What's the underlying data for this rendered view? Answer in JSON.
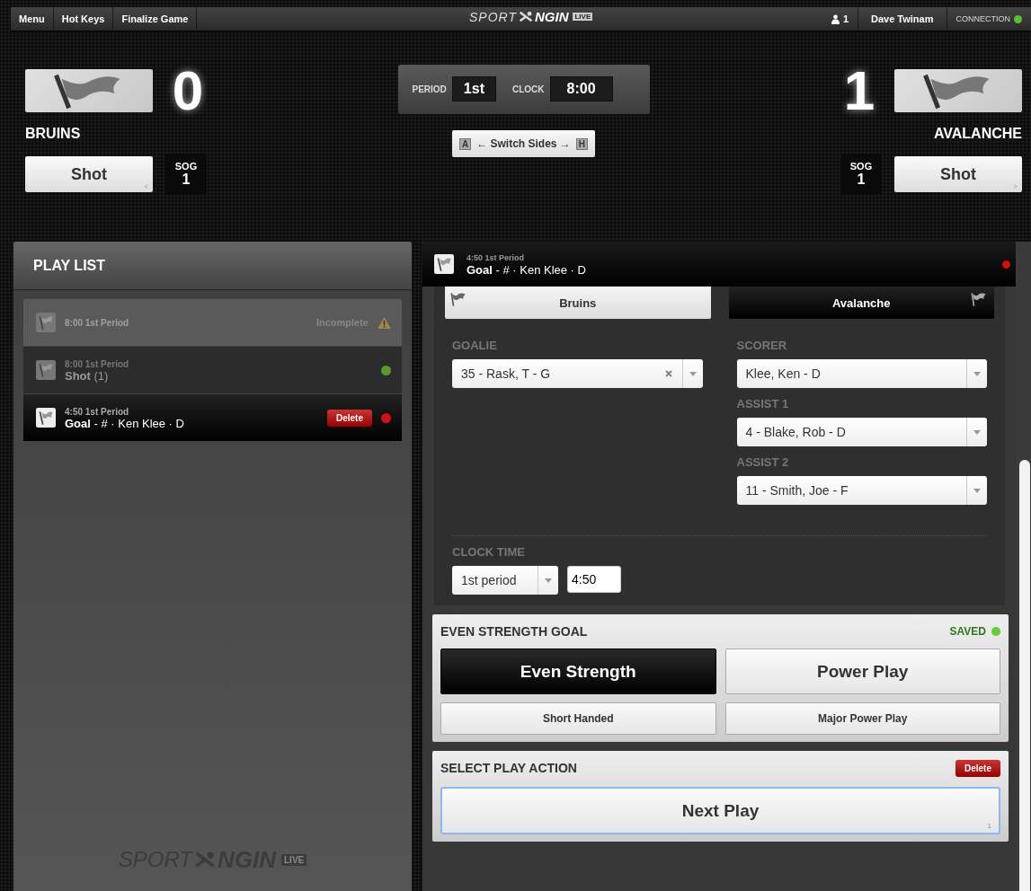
{
  "top_bar": {
    "menu_items": [
      "Menu",
      "Hot Keys",
      "Finalize Game"
    ],
    "logo": {
      "left": "SPORT",
      "right": "NGIN",
      "badge": "LIVE"
    },
    "user_count": "1",
    "user_name": "Dave Twinam",
    "connection": {
      "label": "CONNECTION",
      "connected": true
    }
  },
  "scoreboard": {
    "teams": [
      {
        "name": "BRUINS",
        "score": "0",
        "button": "Shot",
        "hotkey": "<",
        "sog_label": "SOG",
        "sog": "1"
      },
      {
        "name": "AVALANCHE",
        "score": "1",
        "button": "Shot",
        "hotkey": ">",
        "sog_label": "SOG",
        "sog": "1"
      }
    ],
    "period": {
      "label": "PERIOD",
      "value": "1st"
    },
    "clock": {
      "label": "CLOCK",
      "value": "8:00"
    },
    "switch_sides": {
      "left_badge": "A",
      "label": "← Switch Sides →",
      "right_badge": "H"
    }
  },
  "play_list": {
    "title": "PLAY LIST",
    "items": [
      {
        "time": "8:00 1st Period",
        "kind": "incomplete",
        "status_label": "Incomplete",
        "selected": false
      },
      {
        "time": "8:00 1st Period",
        "title": "**Shot** (1)",
        "kind": "saved",
        "selected": false
      },
      {
        "time": "4:50 1st Period",
        "title": "**Goal** - # · Ken Klee · D",
        "kind": "error",
        "delete_label": "Delete",
        "selected": true
      }
    ],
    "footer_logo": {
      "left": "SPORT",
      "right": "NGIN",
      "badge": "LIVE"
    }
  },
  "detail": {
    "header": {
      "time": "4:50 1st Period",
      "title": "**Goal** - # · Ken Klee · D",
      "color": "#d40f0f"
    },
    "team_tabs": [
      {
        "label": "Bruins",
        "selected": false
      },
      {
        "label": "Avalanche",
        "selected": true
      }
    ],
    "left_fields": [
      {
        "label": "GOALIE",
        "value": "35 - Rask, T - G",
        "clearable": true
      }
    ],
    "right_fields": [
      {
        "label": "SCORER",
        "value": "Klee, Ken - D",
        "clearable": false
      },
      {
        "label": "ASSIST 1",
        "value": "4 - Blake, Rob - D",
        "clearable": false
      },
      {
        "label": "ASSIST 2",
        "value": "11 - Smith, Joe - F",
        "clearable": false
      }
    ],
    "clock_time": {
      "label": "CLOCK TIME",
      "period": "1st period",
      "time": "4:50"
    }
  },
  "goal_type": {
    "title": "EVEN STRENGTH GOAL",
    "saved_label": "SAVED",
    "options": [
      {
        "label": "Even Strength",
        "kind": "large",
        "selected": true
      },
      {
        "label": "Power Play",
        "kind": "large",
        "selected": false
      },
      {
        "label": "Short Handed",
        "kind": "small",
        "selected": false
      },
      {
        "label": "Major Power Play",
        "kind": "small",
        "selected": false
      }
    ]
  },
  "play_action": {
    "title": "SELECT PLAY ACTION",
    "delete_label": "Delete",
    "next_button": {
      "label": "Next Play",
      "hotkey": "1"
    }
  }
}
